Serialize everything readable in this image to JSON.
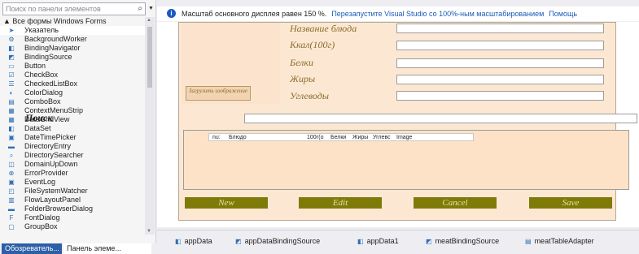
{
  "toolbox": {
    "search_placeholder": "Поиск по панели элементов",
    "category": "▲ Все формы Windows Forms",
    "items": [
      {
        "label": "Указатель",
        "icon": "pointer-icon",
        "glyph": "➤"
      },
      {
        "label": "BackgroundWorker",
        "icon": "background-worker-icon",
        "glyph": "⚙"
      },
      {
        "label": "BindingNavigator",
        "icon": "binding-navigator-icon",
        "glyph": "◧"
      },
      {
        "label": "BindingSource",
        "icon": "binding-source-icon",
        "glyph": "◩"
      },
      {
        "label": "Button",
        "icon": "button-icon",
        "glyph": "▭"
      },
      {
        "label": "CheckBox",
        "icon": "checkbox-icon",
        "glyph": "☑"
      },
      {
        "label": "CheckedListBox",
        "icon": "checked-list-box-icon",
        "glyph": "☰"
      },
      {
        "label": "ColorDialog",
        "icon": "color-dialog-icon",
        "glyph": "◐"
      },
      {
        "label": "ComboBox",
        "icon": "combobox-icon",
        "glyph": "▤"
      },
      {
        "label": "ContextMenuStrip",
        "icon": "context-menu-icon",
        "glyph": "▦"
      },
      {
        "label": "DataGridView",
        "icon": "datagridview-icon",
        "glyph": "▦"
      },
      {
        "label": "DataSet",
        "icon": "dataset-icon",
        "glyph": "◧"
      },
      {
        "label": "DateTimePicker",
        "icon": "datetime-picker-icon",
        "glyph": "▣"
      },
      {
        "label": "DirectoryEntry",
        "icon": "directory-entry-icon",
        "glyph": "▬"
      },
      {
        "label": "DirectorySearcher",
        "icon": "directory-searcher-icon",
        "glyph": "⌕"
      },
      {
        "label": "DomainUpDown",
        "icon": "domain-updown-icon",
        "glyph": "◫"
      },
      {
        "label": "ErrorProvider",
        "icon": "error-provider-icon",
        "glyph": "⊗"
      },
      {
        "label": "EventLog",
        "icon": "event-log-icon",
        "glyph": "▣"
      },
      {
        "label": "FileSystemWatcher",
        "icon": "file-system-watcher-icon",
        "glyph": "◰"
      },
      {
        "label": "FlowLayoutPanel",
        "icon": "flow-layout-panel-icon",
        "glyph": "▥"
      },
      {
        "label": "FolderBrowserDialog",
        "icon": "folder-browser-icon",
        "glyph": "▬"
      },
      {
        "label": "FontDialog",
        "icon": "font-dialog-icon",
        "glyph": "F"
      },
      {
        "label": "GroupBox",
        "icon": "groupbox-icon",
        "glyph": "▢"
      }
    ],
    "tabs": {
      "explorer": "Обозреватель...",
      "toolbox": "Панель элеме..."
    }
  },
  "infobar": {
    "message": "Масштаб основного дисплея равен 150 %.",
    "link_restart": "Перезапустите Visual Studio со 100%-ным масштабированием",
    "link_help": "Помощь"
  },
  "form": {
    "load_image_button": "Загрузить изображение",
    "labels": {
      "name": "Название блюда",
      "calories": "Ккал(100г)",
      "proteins": "Белки",
      "fats": "Жиры",
      "carbs": "Углеводы"
    },
    "search_label": "Поиск",
    "grid_columns": [
      "nu:",
      "Блюдо",
      "100г(о",
      "Белки",
      "Жиры",
      "Углевс",
      "Image"
    ],
    "buttons": {
      "new": "New",
      "edit": "Edit",
      "cancel": "Cancel",
      "save": "Save"
    }
  },
  "tray": {
    "items": [
      "appData",
      "appDataBindingSource",
      "appData1",
      "meatBindingSource",
      "meatTableAdapter"
    ]
  },
  "colors": {
    "form_back": "#fce8d2",
    "button_back": "#807a08",
    "label_color": "#8b6b2e",
    "tab_active": "#2d5ea8"
  }
}
